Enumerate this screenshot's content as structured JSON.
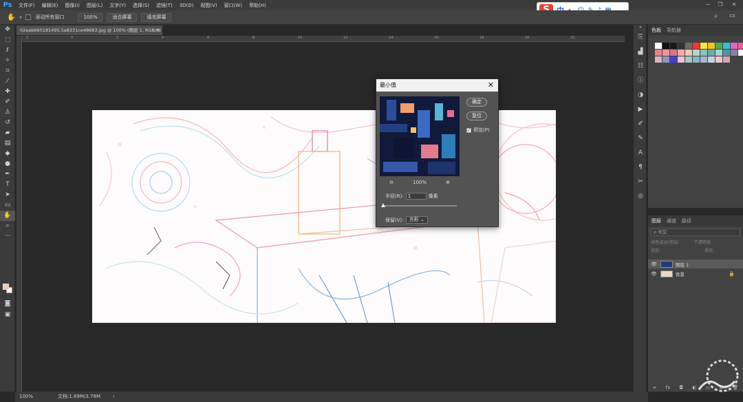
{
  "menubar": {
    "logo": "Ps",
    "items": [
      "文件(F)",
      "编辑(E)",
      "图像(I)",
      "图层(L)",
      "文字(Y)",
      "选择(S)",
      "滤镜(T)",
      "3D(D)",
      "视图(V)",
      "窗口(W)",
      "帮助(H)"
    ]
  },
  "ime": {
    "logo": "S",
    "mode": "中"
  },
  "options": {
    "scroll_all_label": "滚动所有窗口",
    "zoom_value": "100%",
    "fit_screen": "适合屏幕",
    "fill_screen": "填充屏幕"
  },
  "document": {
    "tab_title": "02eab660181495.5a8331ce48683.jpg @ 100% (图层 1, RGB/8) *",
    "ruler_h": [
      "2",
      "0",
      "2",
      "4",
      "6",
      "8",
      "10",
      "12",
      "14",
      "16",
      "18",
      "20",
      "22"
    ]
  },
  "status": {
    "zoom": "100%",
    "doc": "文档:1.89M/3.78M"
  },
  "dialog": {
    "title": "最小值",
    "ok": "确定",
    "reset": "复位",
    "preview_label": "预览(P)",
    "zoom": "100%",
    "radius_label": "半径(R):",
    "radius_value": "1",
    "radius_unit": "像素",
    "preserve_label": "保留(V):",
    "preserve_value": "方形"
  },
  "color_panel": {
    "tabs": [
      "色板",
      "导航器"
    ],
    "swatches": [
      "#fefefe",
      "#111111",
      "#1a1a1a",
      "#333333",
      "#6b6b6b",
      "#ff3232",
      "#f5e642",
      "#f0c51e",
      "#47b04b",
      "#2dc2d6",
      "#d96bc6",
      "#f25c8f",
      "#e8818d",
      "#ef95a3",
      "#d27a86",
      "#f2aab0",
      "#f0c6b5",
      "#b0d8d3",
      "#89c2be",
      "#6fa9b0",
      "#a3d1d0",
      "#4f97a5",
      "#8a7ea6",
      "#ffffff",
      "#e4b2bf",
      "#8d98b8",
      "#4a3bd6",
      "#e9c5cc",
      "#a6c7cf",
      "#8ab7c2",
      "#9fbad0",
      "#c4d5df",
      "#edc7cf",
      "#d0a7b2"
    ]
  },
  "layers_panel": {
    "tabs": [
      "图层",
      "通道",
      "路径"
    ],
    "filter_placeholder": "ρ 类型",
    "blend_mode": "线性减淡(添加)",
    "opacity_label": "不透明度:",
    "lock_label": "锁定:",
    "fill_label": "填充:",
    "layers": [
      {
        "name": "图层 1"
      },
      {
        "name": "背景"
      }
    ]
  }
}
